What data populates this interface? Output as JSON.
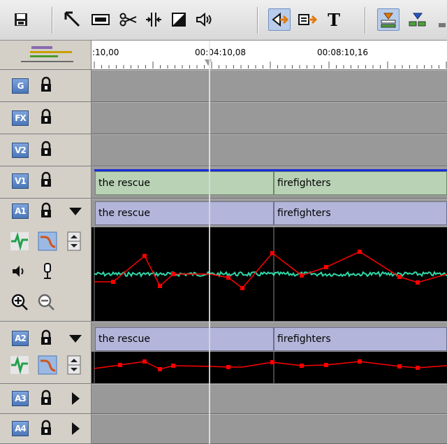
{
  "toolbar": {
    "buttons": [
      {
        "name": "save-button",
        "icon": "floppy-disk-icon"
      },
      {
        "name": "select-tool-button",
        "icon": "arrow-pointer-icon"
      },
      {
        "name": "keyboard-tool-button",
        "icon": "keyboard-icon"
      },
      {
        "name": "cut-tool-button",
        "icon": "scissors-icon"
      },
      {
        "name": "trim-tool-button",
        "icon": "trim-icon"
      },
      {
        "name": "fill-tool-button",
        "icon": "contrast-icon"
      },
      {
        "name": "audio-tool-button",
        "icon": "speaker-icon"
      },
      {
        "name": "insert-mode-button",
        "icon": "insert-mode-icon"
      },
      {
        "name": "overwrite-mode-button",
        "icon": "overwrite-mode-icon"
      },
      {
        "name": "title-button",
        "icon": "title-text-icon"
      },
      {
        "name": "marker-a-button",
        "icon": "marker-orange-icon"
      },
      {
        "name": "marker-b-button",
        "icon": "marker-blue-icon"
      }
    ],
    "title_glyph": "T"
  },
  "ruler": {
    "labels": [
      ":10,00",
      "00:04:10,08",
      "00:08:10,16"
    ]
  },
  "tracks": {
    "g": {
      "label": "G"
    },
    "fx": {
      "label": "FX"
    },
    "v2": {
      "label": "V2"
    },
    "v1": {
      "label": "V1",
      "clips": [
        "the rescue",
        "",
        "firefighters"
      ]
    },
    "a1": {
      "label": "A1",
      "clips": [
        "the rescue",
        "",
        "firefighters"
      ]
    },
    "a2": {
      "label": "A2",
      "clips": [
        "the rescue",
        "",
        "firefighters"
      ]
    },
    "a3": {
      "label": "A3"
    },
    "a4": {
      "label": "A4"
    }
  },
  "colors": {
    "accent": "#4b76b8",
    "waveform": "#2fd8a8",
    "rubberband": "#ff0000",
    "video_clip": "#b9d2b6",
    "audio_clip": "#b3b6da"
  }
}
